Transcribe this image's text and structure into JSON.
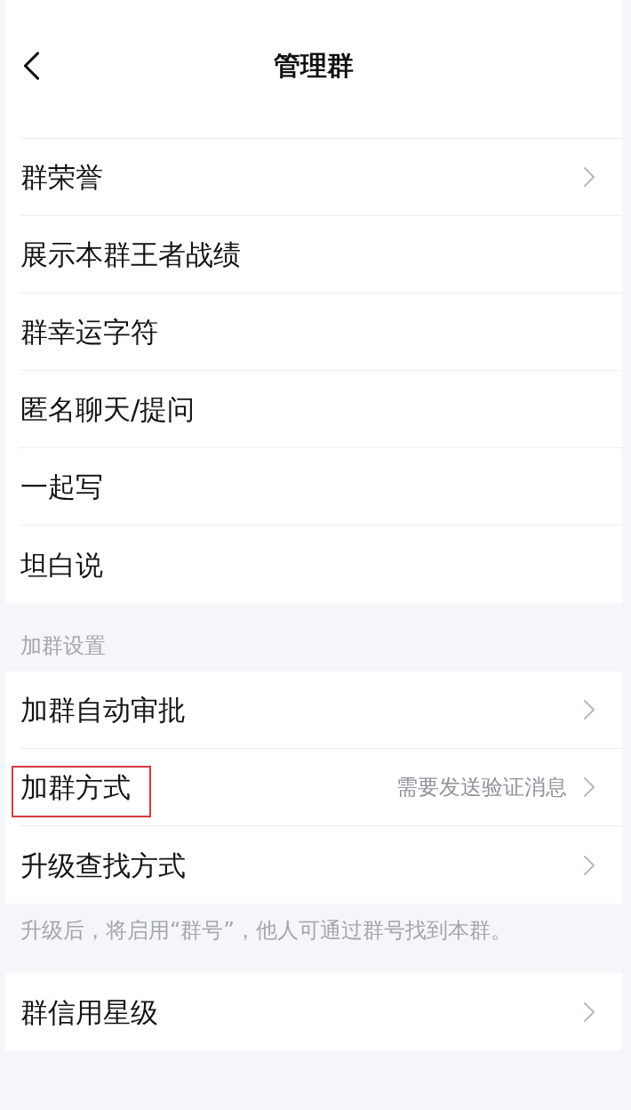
{
  "header": {
    "title": "管理群"
  },
  "sections": [
    {
      "items": [
        {
          "label": "群荣誉",
          "chevron": true,
          "highlighted": false
        },
        {
          "label": "展示本群王者战绩",
          "chevron": false,
          "highlighted": false
        },
        {
          "label": "群幸运字符",
          "chevron": false,
          "highlighted": false
        },
        {
          "label": "匿名聊天/提问",
          "chevron": false,
          "highlighted": false
        },
        {
          "label": "一起写",
          "chevron": false,
          "highlighted": false
        },
        {
          "label": "坦白说",
          "chevron": false,
          "highlighted": false
        }
      ]
    },
    {
      "title": "加群设置",
      "items": [
        {
          "label": "加群自动审批",
          "chevron": true,
          "highlighted": false
        },
        {
          "label": "加群方式",
          "value": "需要发送验证消息",
          "chevron": true,
          "highlighted": true
        },
        {
          "label": "升级查找方式",
          "chevron": true,
          "highlighted": false
        }
      ],
      "footnote": "升级后，将启用“群号”，他人可通过群号找到本群。"
    },
    {
      "items": [
        {
          "label": "群信用星级",
          "chevron": true,
          "highlighted": false
        }
      ]
    }
  ]
}
